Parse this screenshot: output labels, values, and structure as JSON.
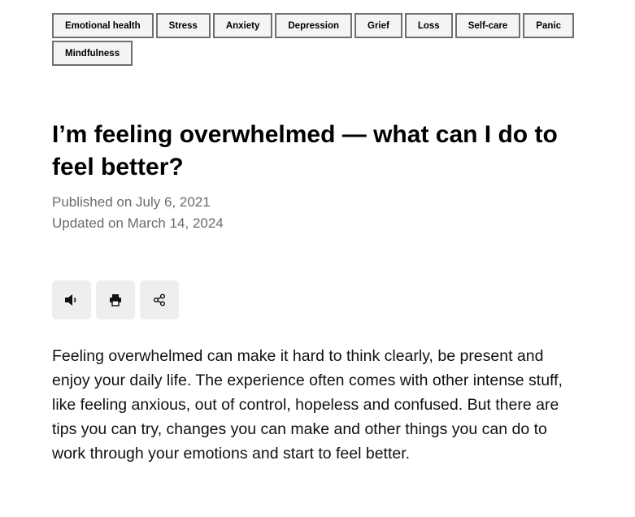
{
  "tags": [
    "Emotional health",
    "Stress",
    "Anxiety",
    "Depression",
    "Grief",
    "Loss",
    "Self-care",
    "Panic",
    "Mindfulness"
  ],
  "article": {
    "title": "I’m feeling overwhelmed — what can I do to feel better?",
    "published": "Published on July 6, 2021",
    "updated": "Updated on March 14, 2024",
    "intro": "Feeling overwhelmed can make it hard to think clearly, be present and enjoy your daily life. The experience often comes with other intense stuff, like feeling anxious, out of control, hopeless and confused. But there are tips you can try, changes you can make and other things you can do to work through your emotions and start to feel better."
  },
  "actions": {
    "listen_icon": "speaker-icon",
    "print_icon": "printer-icon",
    "share_icon": "share-icon"
  }
}
